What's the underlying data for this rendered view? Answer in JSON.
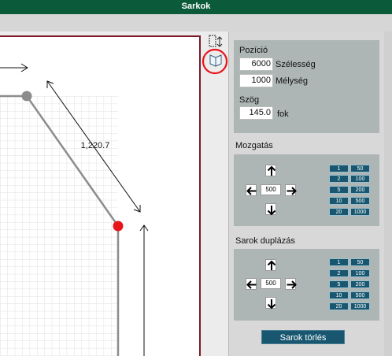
{
  "window": {
    "title": "Sarkok"
  },
  "position": {
    "heading": "Pozíció",
    "width_value": "6000",
    "width_label": "Szélesség",
    "depth_value": "1000",
    "depth_label": "Mélység",
    "angle_heading": "Szög",
    "angle_value": "145.0",
    "angle_unit": "fok"
  },
  "move": {
    "heading": "Mozgatás",
    "step_value": "500",
    "presets": [
      "1",
      "50",
      "2",
      "100",
      "5",
      "200",
      "10",
      "500",
      "20",
      "1000"
    ]
  },
  "duplicate": {
    "heading": "Sarok duplázás",
    "step_value": "500",
    "presets": [
      "1",
      "50",
      "2",
      "100",
      "5",
      "200",
      "10",
      "500",
      "20",
      "1000"
    ]
  },
  "actions": {
    "delete_corner": "Sarok törlés"
  },
  "drawing": {
    "dimension_label": "1,220.7",
    "accent": "#e8141b"
  }
}
